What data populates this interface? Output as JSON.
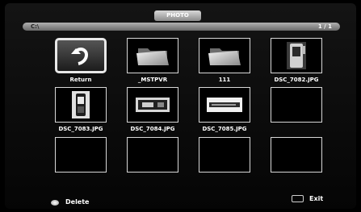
{
  "header": {
    "title": "PHOTO",
    "path": "C:\\",
    "page": "1 / 1"
  },
  "grid": [
    {
      "label": "Return",
      "icon": "return-icon",
      "selected": true
    },
    {
      "label": "_MSTPVR",
      "icon": "folder-icon"
    },
    {
      "label": "111",
      "icon": "folder-icon"
    },
    {
      "label": "DSC_7082.JPG",
      "icon": "photo-thumbnail"
    },
    {
      "label": "DSC_7083.JPG",
      "icon": "photo-thumbnail"
    },
    {
      "label": "DSC_7084.JPG",
      "icon": "photo-thumbnail"
    },
    {
      "label": "DSC_7085.JPG",
      "icon": "photo-thumbnail"
    },
    {
      "label": "",
      "icon": "empty"
    },
    {
      "label": "",
      "icon": "empty"
    },
    {
      "label": "",
      "icon": "empty"
    },
    {
      "label": "",
      "icon": "empty"
    },
    {
      "label": "",
      "icon": "empty"
    }
  ],
  "footer": {
    "delete_label": "Delete",
    "exit_label": "Exit"
  }
}
